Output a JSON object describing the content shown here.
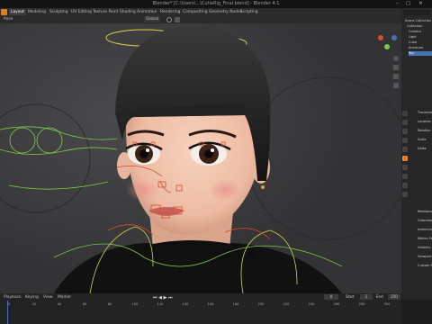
{
  "window": {
    "title": "Blender* [C:\\Users\\...\\CutieRig_Final.blend] - Blender 4.1",
    "minimize_glyph": "–",
    "maximize_glyph": "□",
    "close_glyph": "✕"
  },
  "menubar": {
    "tabs": [
      "Layout",
      "Modeling",
      "Sculpting",
      "UV Editing",
      "Texture Paint",
      "Shading",
      "Animation",
      "Rendering",
      "Compositing",
      "Geometry Nodes",
      "Scripting"
    ],
    "active_tab": "Layout",
    "scene_label": "Scene"
  },
  "viewport_header": {
    "mode": "Pose",
    "transform_orientation": "Global",
    "pose_options_label": "Pose Options"
  },
  "outliner": {
    "search_placeholder": "",
    "items": [
      "Scene Collection",
      "Collection",
      "Camera",
      "Light",
      "Cutie",
      "Armature",
      "Rig"
    ]
  },
  "properties": {
    "rows": [
      "Transform",
      "Location",
      "Rotation",
      "Scale",
      "Delta",
      "Relations",
      "Collections",
      "Instancing",
      "Motion Paths",
      "Visibility",
      "Viewport Display",
      "Custom Props"
    ]
  },
  "timeline": {
    "controls": [
      "Playback",
      "Keying",
      "View",
      "Marker"
    ],
    "current_frame": "0",
    "start_label": "Start",
    "start_value": "1",
    "end_label": "End",
    "end_value": "250",
    "ticks": [
      "0",
      "20",
      "40",
      "60",
      "80",
      "100",
      "120",
      "140",
      "160",
      "180",
      "200",
      "220",
      "240",
      "260",
      "280",
      "300"
    ]
  },
  "colors": {
    "accent": "#4772b3",
    "viewport_bg": "#3a3a3a",
    "bone_yellow": "#d6d24a",
    "bone_green": "#7ec84a",
    "bone_red": "#d84b2b"
  }
}
